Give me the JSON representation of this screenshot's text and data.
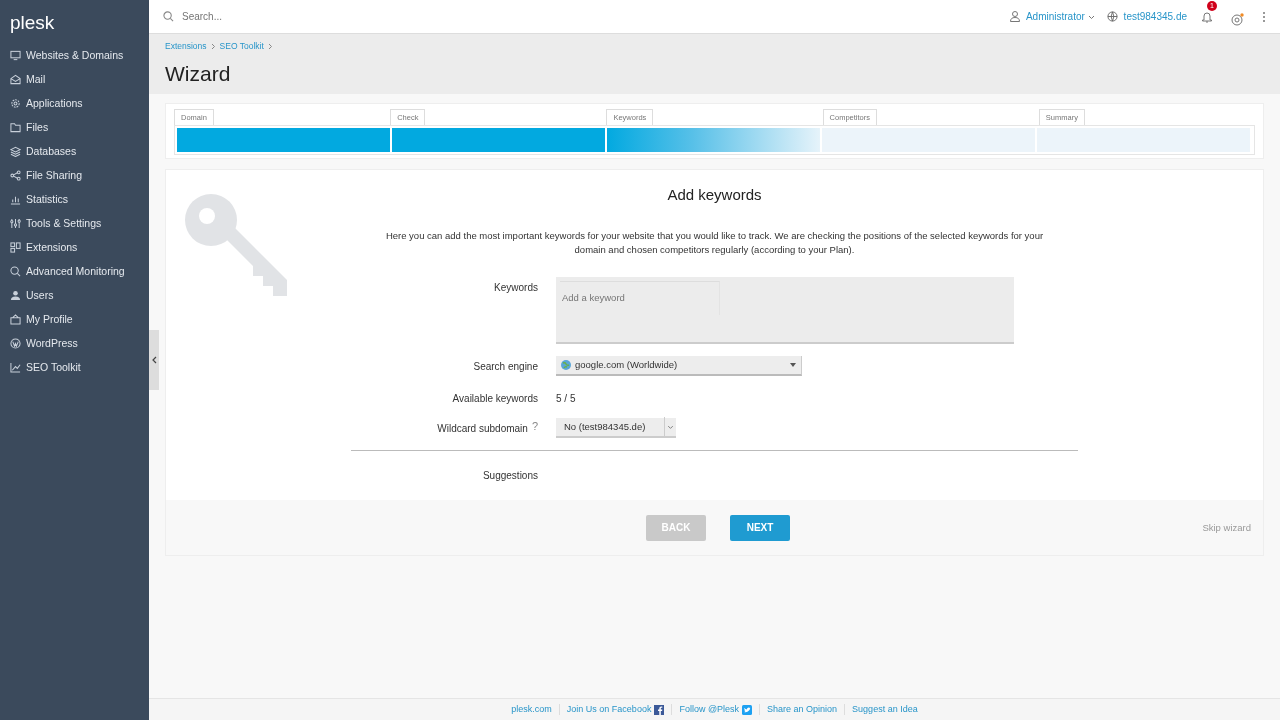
{
  "sidebar": {
    "logo": "plesk",
    "items": [
      {
        "label": "Websites & Domains"
      },
      {
        "label": "Mail"
      },
      {
        "label": "Applications"
      },
      {
        "label": "Files"
      },
      {
        "label": "Databases"
      },
      {
        "label": "File Sharing"
      },
      {
        "label": "Statistics"
      },
      {
        "label": "Tools & Settings"
      },
      {
        "label": "Extensions"
      },
      {
        "label": "Advanced Monitoring"
      },
      {
        "label": "Users"
      },
      {
        "label": "My Profile"
      },
      {
        "label": "WordPress"
      },
      {
        "label": "SEO Toolkit"
      }
    ]
  },
  "topbar": {
    "search_placeholder": "Search...",
    "user": "Administrator",
    "domain": "test984345.de",
    "notification_count": "1"
  },
  "breadcrumbs": [
    "Extensions",
    "SEO Toolkit"
  ],
  "page_title": "Wizard",
  "steps": [
    {
      "label": "Domain",
      "completed": true,
      "selected": false
    },
    {
      "label": "Check",
      "completed": true,
      "selected": false
    },
    {
      "label": "Keywords",
      "completed": false,
      "selected": true
    },
    {
      "label": "Competitors",
      "completed": false,
      "selected": false
    },
    {
      "label": "Summary",
      "completed": false,
      "selected": false
    }
  ],
  "form": {
    "title": "Add keywords",
    "description": "Here you can add the most important keywords for your website that you would like to track. We are checking the positions of the selected keywords for your domain and chosen competitors regularly (according to your Plan).",
    "fields": [
      {
        "kind": "keywords",
        "label": "Keywords",
        "placeholder": "Add a keyword"
      },
      {
        "kind": "select",
        "label": "Search engine",
        "value": "google.com (Worldwide)"
      },
      {
        "kind": "text",
        "label": "Available keywords",
        "value": "5 / 5"
      },
      {
        "kind": "combo",
        "label": "Wildcard subdomain",
        "help": "?",
        "value": "No (test984345.de)"
      },
      {
        "kind": "divider"
      },
      {
        "kind": "text",
        "label": "Suggestions"
      }
    ]
  },
  "buttons": [
    {
      "label": "BACK",
      "disabled": true
    },
    {
      "label": "NEXT",
      "disabled": false
    }
  ],
  "skip_link": "Skip wizard",
  "footer": [
    "plesk.com",
    "Join Us on Facebook",
    "Follow @Plesk",
    "Share an Opinion",
    "Suggest an Idea"
  ]
}
